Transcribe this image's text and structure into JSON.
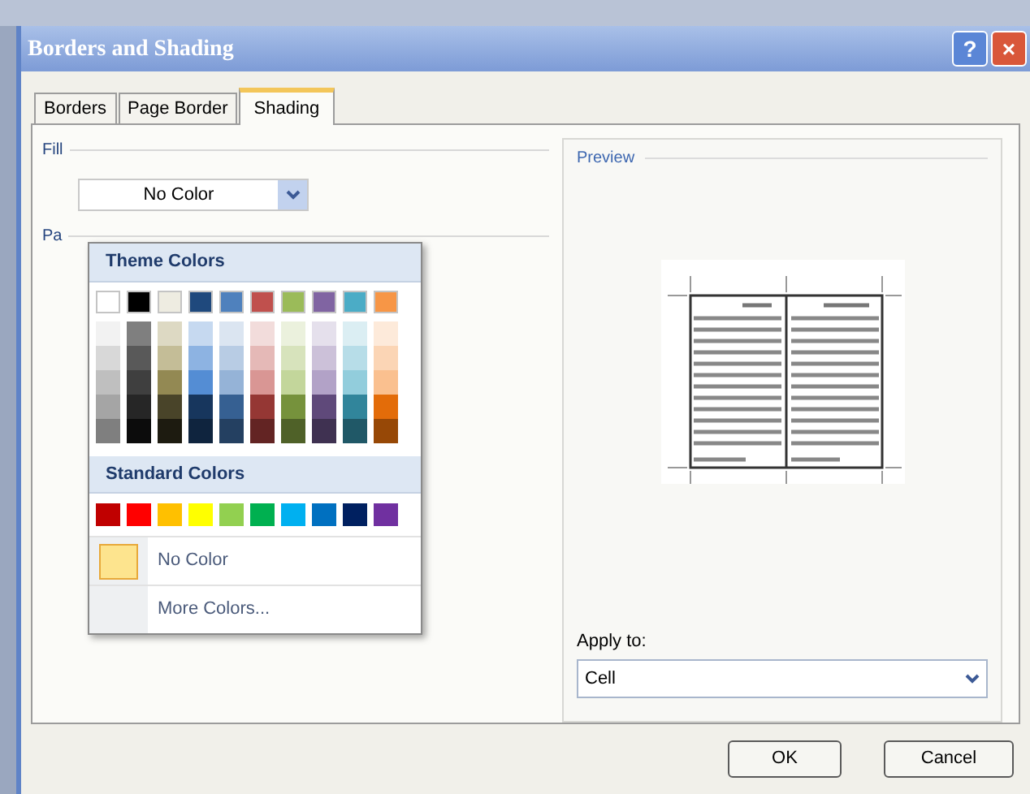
{
  "window": {
    "title": "Borders and Shading",
    "buttons": [
      "?",
      "×"
    ]
  },
  "tabs": [
    {
      "label": "Borders",
      "selected": false
    },
    {
      "label": "Page Border",
      "selected": false
    },
    {
      "label": "Shading",
      "selected": true
    }
  ],
  "fill": {
    "label": "Fill",
    "value": "No Color",
    "pattern_label": "Pa"
  },
  "color_menu": {
    "theme_heading": "Theme Colors",
    "theme_colors": [
      {
        "color": "#ffffff",
        "shades": [
          {
            "color": "#f2f2f2"
          },
          {
            "color": "#d8d8d8"
          },
          {
            "color": "#bfbfbf"
          },
          {
            "color": "#a5a5a5"
          },
          {
            "color": "#7f7f7f"
          }
        ]
      },
      {
        "color": "#000000",
        "shades": [
          {
            "color": "#7f7f7f"
          },
          {
            "color": "#595959"
          },
          {
            "color": "#3f3f3f"
          },
          {
            "color": "#262626"
          },
          {
            "color": "#0c0c0c"
          }
        ]
      },
      {
        "color": "#eeece1",
        "shades": [
          {
            "color": "#ddd9c3"
          },
          {
            "color": "#c4bd97"
          },
          {
            "color": "#938953"
          },
          {
            "color": "#494429"
          },
          {
            "color": "#1d1b10"
          }
        ]
      },
      {
        "color": "#1f497d",
        "shades": [
          {
            "color": "#c6d9f0"
          },
          {
            "color": "#8db3e2"
          },
          {
            "color": "#548dd4"
          },
          {
            "color": "#17365d"
          },
          {
            "color": "#0f243e"
          }
        ]
      },
      {
        "color": "#4f81bd",
        "shades": [
          {
            "color": "#dbe5f1"
          },
          {
            "color": "#b8cce4"
          },
          {
            "color": "#95b3d7"
          },
          {
            "color": "#366092"
          },
          {
            "color": "#244061"
          }
        ]
      },
      {
        "color": "#c0504d",
        "shades": [
          {
            "color": "#f2dcdb"
          },
          {
            "color": "#e5b9b7"
          },
          {
            "color": "#d99694"
          },
          {
            "color": "#953734"
          },
          {
            "color": "#632423"
          }
        ]
      },
      {
        "color": "#9bbb59",
        "shades": [
          {
            "color": "#ebf1dd"
          },
          {
            "color": "#d7e3bc"
          },
          {
            "color": "#c3d69b"
          },
          {
            "color": "#76923c"
          },
          {
            "color": "#4f6128"
          }
        ]
      },
      {
        "color": "#8064a2",
        "shades": [
          {
            "color": "#e5e0ec"
          },
          {
            "color": "#ccc1d9"
          },
          {
            "color": "#b2a2c7"
          },
          {
            "color": "#5f497a"
          },
          {
            "color": "#3f3151"
          }
        ]
      },
      {
        "color": "#4bacc6",
        "shades": [
          {
            "color": "#dbeef3"
          },
          {
            "color": "#b7dde8"
          },
          {
            "color": "#92cddc"
          },
          {
            "color": "#31859b"
          },
          {
            "color": "#205867"
          }
        ]
      },
      {
        "color": "#f79646",
        "shades": [
          {
            "color": "#fdeada"
          },
          {
            "color": "#fbd5b5"
          },
          {
            "color": "#fac08f"
          },
          {
            "color": "#e36c09"
          },
          {
            "color": "#974806"
          }
        ]
      }
    ],
    "standard_heading": "Standard Colors",
    "standard_colors": [
      {
        "color": "#c00000"
      },
      {
        "color": "#ff0000"
      },
      {
        "color": "#ffc000"
      },
      {
        "color": "#ffff00"
      },
      {
        "color": "#92d050"
      },
      {
        "color": "#00b050"
      },
      {
        "color": "#00b0f0"
      },
      {
        "color": "#0070c0"
      },
      {
        "color": "#002060"
      },
      {
        "color": "#7030a0"
      }
    ],
    "items": [
      {
        "label": "No Color",
        "kind": "swatch"
      },
      {
        "label": "More Colors...",
        "kind": "plain"
      }
    ]
  },
  "preview": {
    "label": "Preview"
  },
  "apply_to": {
    "label": "Apply to:",
    "value": "Cell"
  },
  "buttons": [
    "OK",
    "Cancel"
  ]
}
